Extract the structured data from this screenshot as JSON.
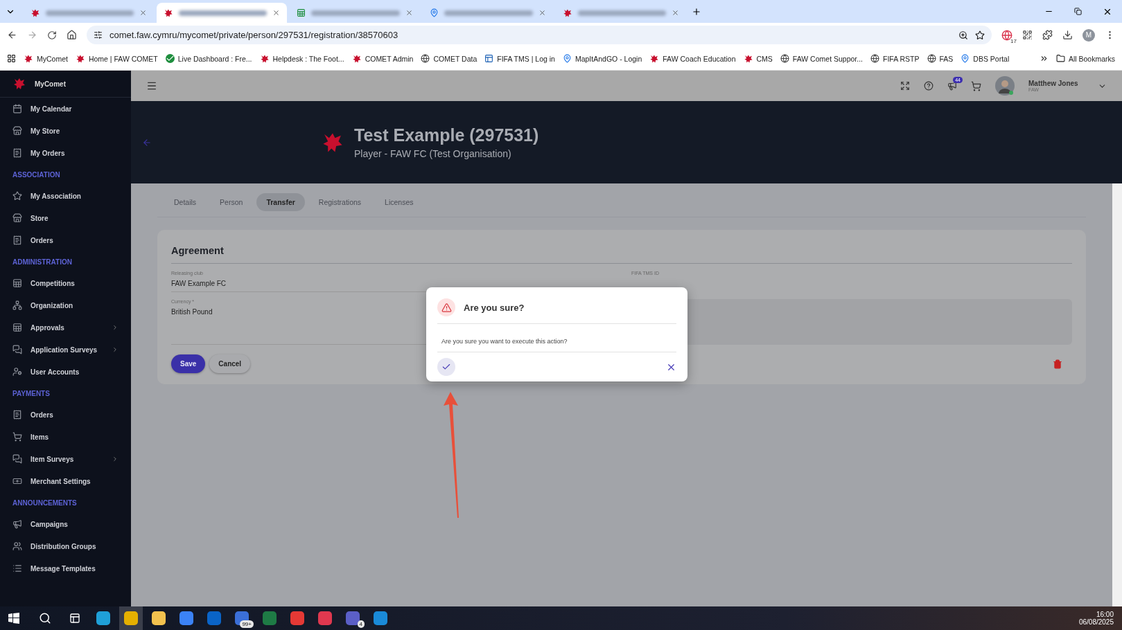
{
  "browser": {
    "tabs": [
      {
        "selected": false,
        "kind": "dragon"
      },
      {
        "selected": true,
        "kind": "dragon"
      },
      {
        "selected": false,
        "kind": "sheet"
      },
      {
        "selected": false,
        "kind": "map"
      },
      {
        "selected": false,
        "kind": "dragon"
      }
    ],
    "url": "comet.faw.cymru/mycomet/private/person/297531/registration/38570603",
    "extension_badge": "17",
    "profile_initial": "M",
    "bookmarks": [
      {
        "label": "MyComet",
        "kind": "dragon"
      },
      {
        "label": "Home | FAW COMET",
        "kind": "dragon"
      },
      {
        "label": "Live Dashboard : Fre...",
        "kind": "check"
      },
      {
        "label": "Helpdesk : The Foot...",
        "kind": "dragon"
      },
      {
        "label": "COMET Admin",
        "kind": "dragon"
      },
      {
        "label": "COMET Data",
        "kind": "globe"
      },
      {
        "label": "FIFA TMS | Log in",
        "kind": "fifa"
      },
      {
        "label": "MapItAndGO - Login",
        "kind": "map"
      },
      {
        "label": "FAW Coach Education",
        "kind": "dragon"
      },
      {
        "label": "CMS",
        "kind": "dragon"
      },
      {
        "label": "FAW Comet Suppor...",
        "kind": "globe"
      },
      {
        "label": "FIFA RSTP",
        "kind": "globe"
      },
      {
        "label": "FAS",
        "kind": "globe"
      },
      {
        "label": "DBS Portal",
        "kind": "map"
      }
    ],
    "all_bookmarks": "All Bookmarks"
  },
  "sidebar": {
    "brand": "MyComet",
    "sections": [
      {
        "items": [
          {
            "label": "My Calendar",
            "kind": "calendar",
            "submenu": false
          },
          {
            "label": "My Store",
            "kind": "store",
            "submenu": false
          },
          {
            "label": "My Orders",
            "kind": "receipt",
            "submenu": false
          }
        ]
      },
      {
        "heading": "ASSOCIATION",
        "items": [
          {
            "label": "My Association",
            "kind": "star",
            "submenu": false
          },
          {
            "label": "Store",
            "kind": "store",
            "submenu": false
          },
          {
            "label": "Orders",
            "kind": "receipt",
            "submenu": false
          }
        ]
      },
      {
        "heading": "ADMINISTRATION",
        "items": [
          {
            "label": "Competitions",
            "kind": "table",
            "submenu": false
          },
          {
            "label": "Organization",
            "kind": "network",
            "submenu": false
          },
          {
            "label": "Approvals",
            "kind": "table",
            "submenu": true
          },
          {
            "label": "Application Surveys",
            "kind": "chat",
            "submenu": true
          },
          {
            "label": "User Accounts",
            "kind": "usercog",
            "submenu": false
          }
        ]
      },
      {
        "heading": "PAYMENTS",
        "items": [
          {
            "label": "Orders",
            "kind": "receipt",
            "submenu": false
          },
          {
            "label": "Items",
            "kind": "cart",
            "submenu": false
          },
          {
            "label": "Item Surveys",
            "kind": "chat",
            "submenu": true
          },
          {
            "label": "Merchant Settings",
            "kind": "money",
            "submenu": false
          }
        ]
      },
      {
        "heading": "ANNOUNCEMENTS",
        "items": [
          {
            "label": "Campaigns",
            "kind": "megaphone",
            "submenu": false
          },
          {
            "label": "Distribution Groups",
            "kind": "users",
            "submenu": false
          },
          {
            "label": "Message Templates",
            "kind": "list",
            "submenu": false
          }
        ]
      }
    ]
  },
  "header": {
    "notifications": "44",
    "user_name": "Matthew Jones",
    "user_org": "FAW"
  },
  "banner": {
    "title": "Test Example (297531)",
    "subtitle": "Player - FAW FC (Test Organisation)"
  },
  "tabs": [
    {
      "label": "Details",
      "selected": false
    },
    {
      "label": "Person",
      "selected": false
    },
    {
      "label": "Transfer",
      "selected": true
    },
    {
      "label": "Registrations",
      "selected": false
    },
    {
      "label": "Licenses",
      "selected": false
    }
  ],
  "card": {
    "title": "Agreement",
    "fields": [
      {
        "label": "Releasing club",
        "value": "FAW Example FC"
      },
      {
        "label": "FIFA TMS ID"
      },
      {
        "label": "Currency *",
        "value": "British Pound"
      }
    ],
    "buttons": [
      {
        "label": "Save",
        "kind": "primary"
      },
      {
        "label": "Cancel",
        "kind": "secondary"
      }
    ]
  },
  "dialog": {
    "title": "Are you sure?",
    "message": "Are you sure you want to execute this action?"
  },
  "taskbar": {
    "apps": [
      {
        "kind": "edge"
      },
      {
        "kind": "chrome",
        "selected": true
      },
      {
        "kind": "explorer"
      },
      {
        "kind": "store"
      },
      {
        "kind": "outlook"
      },
      {
        "kind": "todo",
        "badge": "99+"
      },
      {
        "kind": "excel"
      },
      {
        "kind": "dots"
      },
      {
        "kind": "red"
      },
      {
        "kind": "teams",
        "badge": "4"
      },
      {
        "kind": "outlooknew"
      }
    ],
    "time": "16:00",
    "date": "06/08/2025"
  }
}
